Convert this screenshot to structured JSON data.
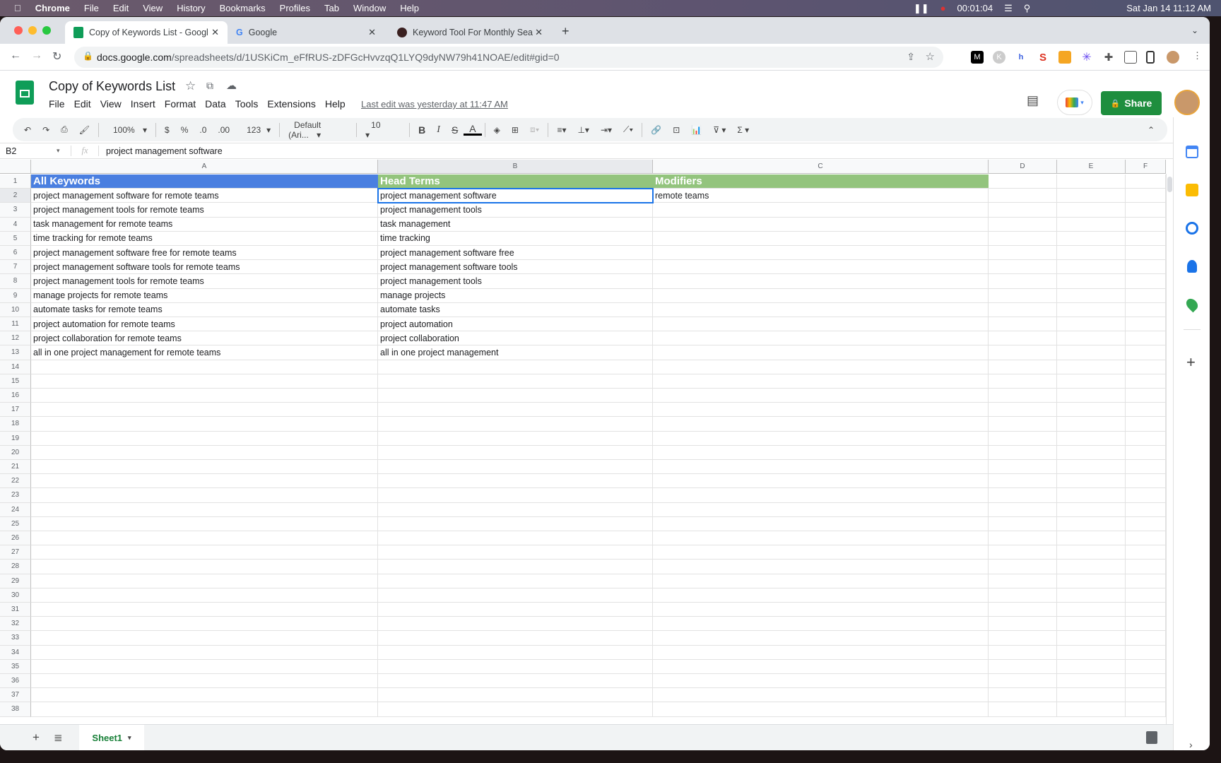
{
  "os_menubar": {
    "app": "Chrome",
    "items": [
      "File",
      "Edit",
      "View",
      "History",
      "Bookmarks",
      "Profiles",
      "Tab",
      "Window",
      "Help"
    ],
    "timer": "00:01:04",
    "datetime": "Sat Jan 14  11:12 AM"
  },
  "browser": {
    "tabs": [
      {
        "title": "Copy of Keywords List - Googl",
        "active": true
      },
      {
        "title": "Google",
        "active": false
      },
      {
        "title": "Keyword Tool For Monthly Sea",
        "active": false
      }
    ],
    "url_host": "docs.google.com",
    "url_path": "/spreadsheets/d/1USKiCm_eFfRUS-zDFGcHvvzqQ1LYQ9dyNW79h41NOAE/edit#gid=0"
  },
  "doc": {
    "title": "Copy of Keywords List",
    "menu": [
      "File",
      "Edit",
      "View",
      "Insert",
      "Format",
      "Data",
      "Tools",
      "Extensions",
      "Help"
    ],
    "last_edit": "Last edit was yesterday at 11:47 AM",
    "share_label": "Share"
  },
  "toolbar": {
    "zoom": "100%",
    "currency": "$",
    "percent": "%",
    "dec_less": ".0",
    "dec_more": ".00",
    "format": "123",
    "font": "Default (Ari...",
    "font_size": "10"
  },
  "formula_bar": {
    "cell_ref": "B2",
    "fx": "fx",
    "value": "project management software"
  },
  "columns": [
    "A",
    "B",
    "C",
    "D",
    "E",
    "F"
  ],
  "header_colors": {
    "A": "#4a7fe0",
    "B": "#93c47d",
    "C": "#93c47d"
  },
  "rows": [
    [
      "All Keywords",
      "Head Terms",
      "Modifiers"
    ],
    [
      "project management software for remote teams",
      "project management software",
      "remote teams"
    ],
    [
      "project management tools for remote teams",
      "project management tools",
      ""
    ],
    [
      "task management for remote teams",
      "task management",
      ""
    ],
    [
      "time tracking for remote teams",
      "time tracking",
      ""
    ],
    [
      "project management software free for remote teams",
      "project management software free",
      ""
    ],
    [
      "project management software tools for remote teams",
      "project management software tools",
      ""
    ],
    [
      "project management tools for remote teams",
      "project management tools",
      ""
    ],
    [
      "manage projects for remote teams",
      "manage projects",
      ""
    ],
    [
      "automate tasks for remote teams",
      "automate tasks",
      ""
    ],
    [
      "project automation for remote teams",
      "project automation",
      ""
    ],
    [
      "project collaboration for remote teams",
      "project collaboration",
      ""
    ],
    [
      "all in one project management for remote teams",
      "all in one project management",
      ""
    ]
  ],
  "visible_row_count": 38,
  "selected_cell": "B2",
  "sheet_tabs": [
    {
      "name": "Sheet1",
      "active": true
    }
  ]
}
